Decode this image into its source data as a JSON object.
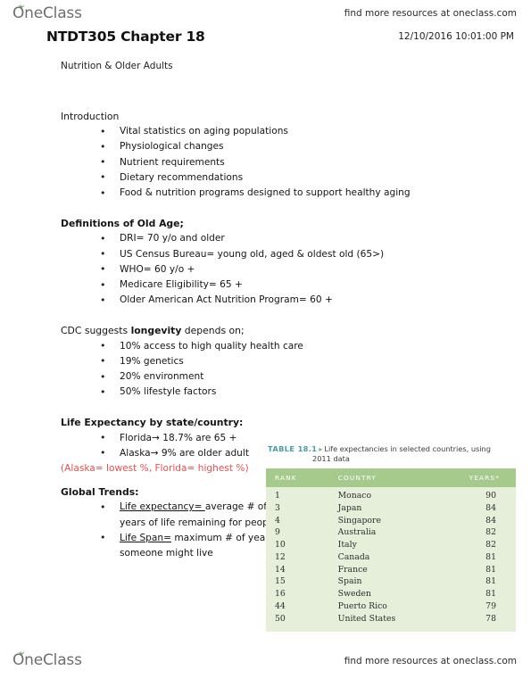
{
  "header": {
    "logo_text": "OneClass",
    "logo_icon": "sprout-leaf-icon",
    "tagline": "find more resources at oneclass.com",
    "doc_title": "NTDT305 Chapter 18",
    "doc_date": "12/10/2016 10:01:00 PM",
    "doc_subtitle": "Nutrition & Older Adults"
  },
  "sections": {
    "introduction": {
      "heading": "Introduction",
      "bullets": [
        "Vital statistics on aging populations",
        "Physiological changes",
        "Nutrient requirements",
        "Dietary recommendations",
        "Food & nutrition programs designed to support healthy aging"
      ]
    },
    "definitions": {
      "heading": "Definitions of Old Age;",
      "bullets": [
        "DRI= 70 y/o and older",
        "US Census Bureau=  young old, aged & oldest old (65>)",
        "WHO= 60 y/o +",
        "Medicare Eligibility= 65 +",
        "Older American Act Nutrition Program= 60 +"
      ]
    },
    "cdc": {
      "heading_pre": "CDC suggests ",
      "heading_bold": "longevity",
      "heading_post": " depends on;",
      "bullets": [
        "10% access to high quality health care",
        "19% genetics",
        "20% environment",
        "50% lifestyle factors"
      ]
    },
    "life_expectancy": {
      "heading": "Life Expectancy by state/country:",
      "bullets": [
        "Florida→ 18.7% are 65 +",
        "Alaska→ 9% are older adult"
      ],
      "note": "(Alaska= lowest %, Florida= highest %)",
      "note_color": "#e8524d"
    },
    "global_trends": {
      "heading": "Global Trends:",
      "bullets": [
        {
          "term": "Life expectancy= ",
          "definition": "average # of years of life remaining for people"
        },
        {
          "term": "Life Span=",
          "definition": " maximum # of years someone might live"
        }
      ]
    }
  },
  "figure": {
    "label": "TABLE 18.1",
    "arrow": "▸",
    "caption_line1": "Life expectancies in selected countries, using",
    "caption_line2": "2011 data",
    "header_bg": "#a6ca8c",
    "body_bg": "#e6efda",
    "label_color": "#4b9ba3",
    "columns": [
      "RANK",
      "COUNTRY",
      "YEARS*"
    ],
    "rows": [
      {
        "rank": "1",
        "country": "Monaco",
        "years": "90"
      },
      {
        "rank": "3",
        "country": "Japan",
        "years": "84"
      },
      {
        "rank": "4",
        "country": "Singapore",
        "years": "84"
      },
      {
        "rank": "9",
        "country": "Australia",
        "years": "82"
      },
      {
        "rank": "10",
        "country": "Italy",
        "years": "82"
      },
      {
        "rank": "12",
        "country": "Canada",
        "years": "81"
      },
      {
        "rank": "14",
        "country": "France",
        "years": "81"
      },
      {
        "rank": "15",
        "country": "Spain",
        "years": "81"
      },
      {
        "rank": "16",
        "country": "Sweden",
        "years": "81"
      },
      {
        "rank": "44",
        "country": "Puerto Rico",
        "years": "79"
      },
      {
        "rank": "50",
        "country": "United States",
        "years": "78"
      }
    ]
  },
  "footer": {
    "logo_text": "OneClass",
    "logo_icon": "sprout-leaf-icon",
    "tagline": "find more resources at oneclass.com"
  }
}
